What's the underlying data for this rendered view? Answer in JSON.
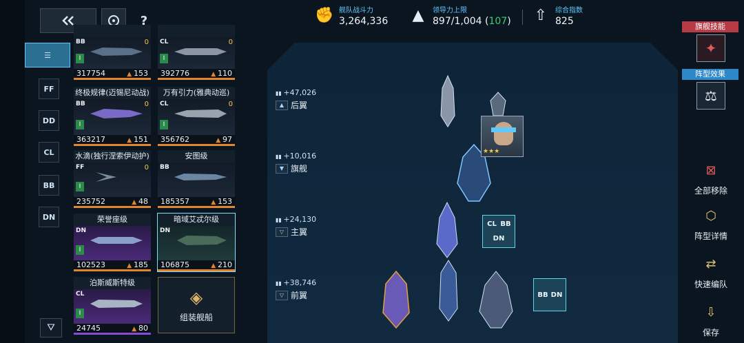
{
  "topbar": {
    "back_icon": "double-chevron-left-icon",
    "target_icon": "target-icon",
    "help_label": "?"
  },
  "stats": {
    "fleet_power": {
      "label": "舰队战斗力",
      "value": "3,264,336",
      "icon": "fist-icon"
    },
    "leadership": {
      "label": "领导力上限",
      "value": "897/1,004",
      "bonus": "107",
      "icon": "leadership-icon"
    },
    "index": {
      "label": "综合指数",
      "value": "825",
      "icon": "rank-icon"
    }
  },
  "class_filters": [
    "FF",
    "DD",
    "CL",
    "BB",
    "DN"
  ],
  "list_icon": "list-icon",
  "filter_icon": "filter-icon",
  "cards": [
    {
      "name": "",
      "cls": "BB",
      "power": "317754",
      "cmd": "153",
      "lock": "0"
    },
    {
      "name": "",
      "cls": "CL",
      "power": "392776",
      "cmd": "110",
      "lock": "0"
    },
    {
      "name": "终极规律(迈锡尼动战)",
      "cls": "BB",
      "power": "363217",
      "cmd": "151",
      "lock": "0"
    },
    {
      "name": "万有引力(雅典动巡)",
      "cls": "CL",
      "power": "356762",
      "cmd": "97",
      "lock": "0"
    },
    {
      "name": "水滴(独行涅索伊动护)",
      "cls": "FF",
      "power": "235752",
      "cmd": "48",
      "lock": "0"
    },
    {
      "name": "安图级",
      "cls": "BB",
      "power": "185357",
      "cmd": "153",
      "lock": ""
    },
    {
      "name": "荣誉座级",
      "cls": "DN",
      "power": "102523",
      "cmd": "185",
      "lock": ""
    },
    {
      "name": "暗域艾忒尔级",
      "cls": "DN",
      "power": "106875",
      "cmd": "210",
      "lock": ""
    },
    {
      "name": "泊斯威斯特级",
      "cls": "CL",
      "power": "24745",
      "cmd": "80",
      "lock": ""
    }
  ],
  "assemble_label": "组装舰船",
  "rows": [
    {
      "power": "+47,026",
      "name": "后翼"
    },
    {
      "power": "+10,016",
      "name": "旗舰"
    },
    {
      "power": "+24,130",
      "name": "主翼"
    },
    {
      "power": "+38,746",
      "name": "前翼"
    }
  ],
  "slots": {
    "main": [
      "CL",
      "BB",
      "DN"
    ],
    "front": [
      "BB",
      "DN"
    ]
  },
  "right_panel": {
    "flagship_skill": "旗舰技能",
    "formation_effect": "阵型效果",
    "remove_all": "全部移除",
    "formation_detail": "阵型详情",
    "quick_edit": "快速编队",
    "save": "保存"
  },
  "colors": {
    "accent": "#5fc8ff",
    "orange_bar": "#e0862c",
    "flagship_tag": "#b83a44",
    "formation_tag": "#2d87c8",
    "green": "#38d36a"
  }
}
